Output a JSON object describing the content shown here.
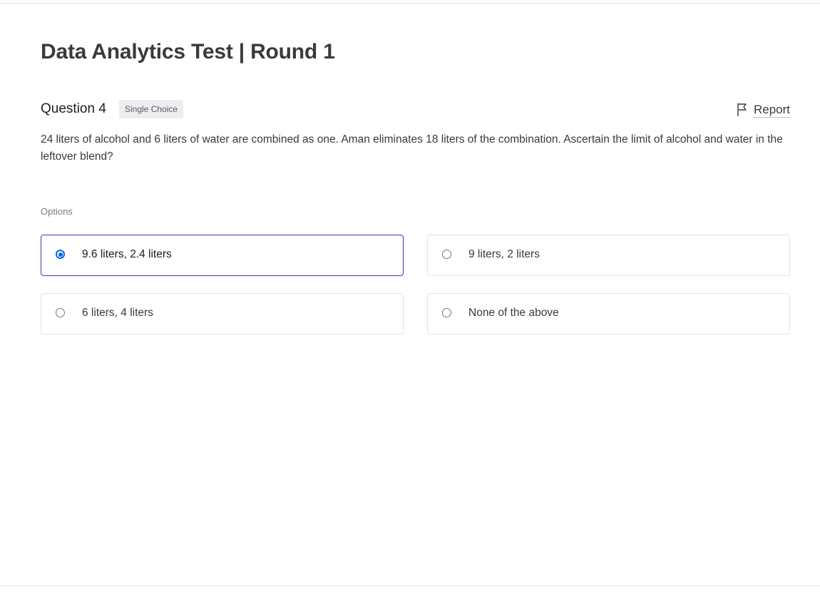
{
  "page": {
    "title": "Data Analytics Test | Round 1"
  },
  "question": {
    "label": "Question 4",
    "type_badge": "Single Choice",
    "report_label": "Report",
    "report_icon": "flag-icon",
    "text": "24 liters of alcohol and 6 liters of water are combined as one. Aman eliminates 18 liters of the combination. Ascertain the limit of alcohol and water in the leftover blend?"
  },
  "options": {
    "label": "Options",
    "items": [
      {
        "text": "9.6 liters, 2.4 liters",
        "selected": true
      },
      {
        "text": "9 liters, 2 liters",
        "selected": false
      },
      {
        "text": "6 liters, 4 liters",
        "selected": false
      },
      {
        "text": "None of the above",
        "selected": false
      }
    ]
  },
  "colors": {
    "selected_border": "#3a3ab8",
    "radio_selected": "#0a66e0",
    "badge_background": "#eceef2"
  }
}
